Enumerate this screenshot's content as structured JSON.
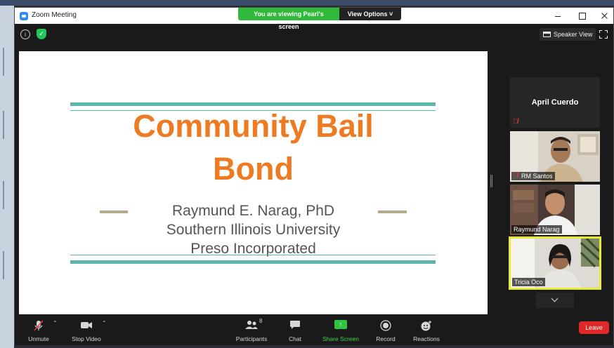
{
  "window": {
    "title": "Zoom Meeting"
  },
  "share_banner": {
    "viewing_text": "You are viewing Pearl's screen",
    "view_options": "View Options ˅"
  },
  "top_bar": {
    "speaker_view": "Speaker View"
  },
  "slide": {
    "title_line1": "Community Bail",
    "title_line2": "Bond",
    "presenter_name": "Raymund E. Narag, PhD",
    "presenter_affiliation": "Southern Illinois University",
    "presenter_company": "Preso Incorporated",
    "colors": {
      "title": "#ee7a21",
      "accent_bars": "#5bb7ac",
      "dash": "#b5ab8c"
    }
  },
  "participants": [
    {
      "name": "April Cuerdo",
      "muted": true,
      "video": false
    },
    {
      "name": "RM Santos",
      "muted": true,
      "video": true
    },
    {
      "name": "Raymund Narag",
      "muted": false,
      "video": true
    },
    {
      "name": "Tricia Oco",
      "muted": false,
      "video": true,
      "active_speaker": true
    }
  ],
  "toolbar": {
    "unmute": "Unmute",
    "stop_video": "Stop Video",
    "participants": "Participants",
    "participants_count": "8",
    "chat": "Chat",
    "share_screen": "Share Screen",
    "record": "Record",
    "reactions": "Reactions",
    "leave": "Leave"
  },
  "icons": [
    "info-icon",
    "shield-icon",
    "speaker-view-icon",
    "fullscreen-icon",
    "mic-muted-icon",
    "video-camera-icon",
    "participants-icon",
    "chat-icon",
    "share-screen-icon",
    "record-icon",
    "reactions-icon",
    "chevron-down-icon"
  ]
}
